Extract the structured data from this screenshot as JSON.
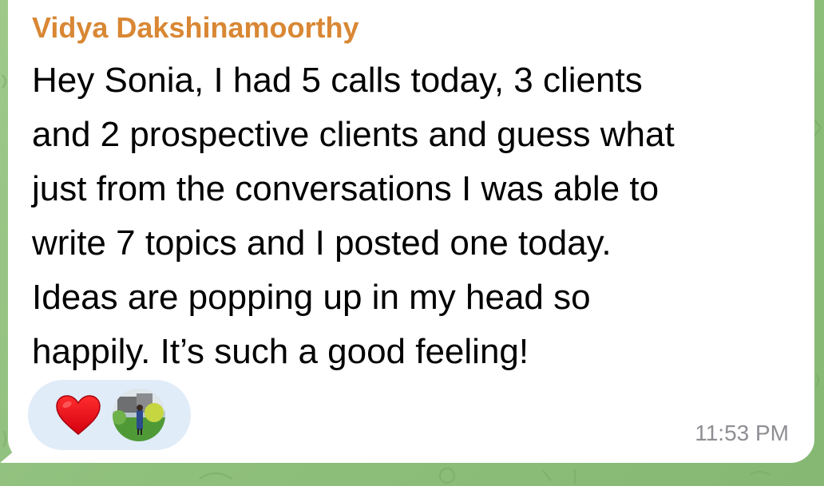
{
  "message": {
    "sender": "Vidya Dakshinamoorthy",
    "lines": [
      "Hey Sonia, I had 5 calls today, 3 clients",
      "and 2 prospective clients and guess what",
      "just from the conversations I was able to",
      "write 7 topics and I posted one today.",
      "Ideas are popping up in my head so",
      "happily. It’s such a good feeling!"
    ],
    "time": "11:53 PM",
    "reaction": {
      "emoji_icon": "heart-icon",
      "reactor_avatar": "avatar"
    }
  },
  "colors": {
    "sender_name": "#d98734",
    "bubble": "#ffffff",
    "reaction_pill": "#e0ecf8",
    "timestamp": "#8e8e93",
    "wallpaper": "#8fc07c"
  }
}
